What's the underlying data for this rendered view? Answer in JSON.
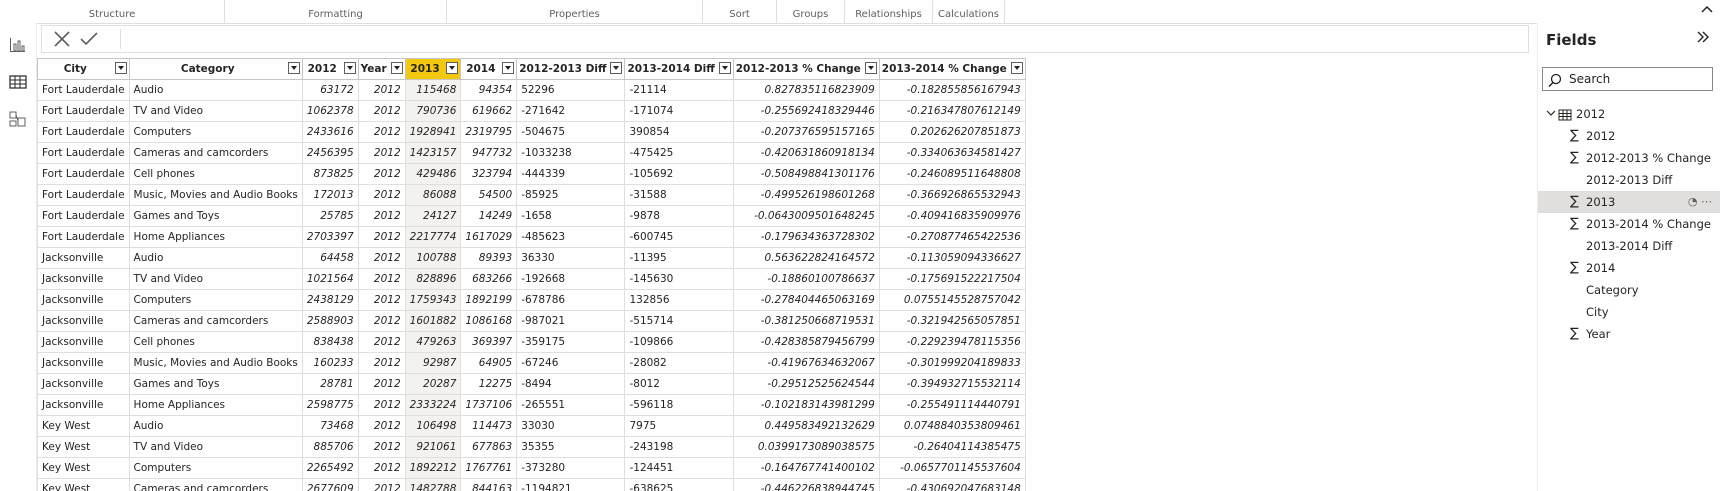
{
  "ribbon": {
    "groups": [
      "Structure",
      "Formatting",
      "Properties",
      "Sort",
      "Groups",
      "Relationships",
      "Calculations"
    ]
  },
  "icons": {
    "rail": [
      "report-view-icon",
      "table-view-icon",
      "model-view-icon"
    ],
    "formula": [
      "cancel-icon",
      "commit-icon"
    ]
  },
  "table": {
    "columns": [
      "City",
      "Category",
      "2012",
      "Year",
      "2013",
      "2014",
      "2012-2013 Diff",
      "2013-2014 Diff",
      "2012-2013 % Change",
      "2013-2014 % Change"
    ],
    "selected_column": "2013",
    "rows": [
      [
        "Fort Lauderdale",
        "Audio",
        "63172",
        "2012",
        "115468",
        "94354",
        "52296",
        "-21114",
        "0.827835116823909",
        "-0.182855856167943"
      ],
      [
        "Fort Lauderdale",
        "TV and Video",
        "1062378",
        "2012",
        "790736",
        "619662",
        "-271642",
        "-171074",
        "-0.255692418329446",
        "-0.216347807612149"
      ],
      [
        "Fort Lauderdale",
        "Computers",
        "2433616",
        "2012",
        "1928941",
        "2319795",
        "-504675",
        "390854",
        "-0.207376595157165",
        "0.202626207851873"
      ],
      [
        "Fort Lauderdale",
        "Cameras and camcorders",
        "2456395",
        "2012",
        "1423157",
        "947732",
        "-1033238",
        "-475425",
        "-0.420631860918134",
        "-0.334063634581427"
      ],
      [
        "Fort Lauderdale",
        "Cell phones",
        "873825",
        "2012",
        "429486",
        "323794",
        "-444339",
        "-105692",
        "-0.508498841301176",
        "-0.246089511648808"
      ],
      [
        "Fort Lauderdale",
        "Music, Movies and Audio Books",
        "172013",
        "2012",
        "86088",
        "54500",
        "-85925",
        "-31588",
        "-0.499526198601268",
        "-0.366926865532943"
      ],
      [
        "Fort Lauderdale",
        "Games and Toys",
        "25785",
        "2012",
        "24127",
        "14249",
        "-1658",
        "-9878",
        "-0.0643009501648245",
        "-0.409416835909976"
      ],
      [
        "Fort Lauderdale",
        "Home Appliances",
        "2703397",
        "2012",
        "2217774",
        "1617029",
        "-485623",
        "-600745",
        "-0.179634363728302",
        "-0.270877465422536"
      ],
      [
        "Jacksonville",
        "Audio",
        "64458",
        "2012",
        "100788",
        "89393",
        "36330",
        "-11395",
        "0.563622824164572",
        "-0.113059094336627"
      ],
      [
        "Jacksonville",
        "TV and Video",
        "1021564",
        "2012",
        "828896",
        "683266",
        "-192668",
        "-145630",
        "-0.18860100786637",
        "-0.175691522217504"
      ],
      [
        "Jacksonville",
        "Computers",
        "2438129",
        "2012",
        "1759343",
        "1892199",
        "-678786",
        "132856",
        "-0.278404465063169",
        "0.0755145528757042"
      ],
      [
        "Jacksonville",
        "Cameras and camcorders",
        "2588903",
        "2012",
        "1601882",
        "1086168",
        "-987021",
        "-515714",
        "-0.381250668719531",
        "-0.321942565057851"
      ],
      [
        "Jacksonville",
        "Cell phones",
        "838438",
        "2012",
        "479263",
        "369397",
        "-359175",
        "-109866",
        "-0.428385879456799",
        "-0.229239478115356"
      ],
      [
        "Jacksonville",
        "Music, Movies and Audio Books",
        "160233",
        "2012",
        "92987",
        "64905",
        "-67246",
        "-28082",
        "-0.41967634632067",
        "-0.301999204189833"
      ],
      [
        "Jacksonville",
        "Games and Toys",
        "28781",
        "2012",
        "20287",
        "12275",
        "-8494",
        "-8012",
        "-0.29512525624544",
        "-0.394932715532114"
      ],
      [
        "Jacksonville",
        "Home Appliances",
        "2598775",
        "2012",
        "2333224",
        "1737106",
        "-265551",
        "-596118",
        "-0.102183143981299",
        "-0.255491114440791"
      ],
      [
        "Key West",
        "Audio",
        "73468",
        "2012",
        "106498",
        "114473",
        "33030",
        "7975",
        "0.449583492132629",
        "0.0748840353809461"
      ],
      [
        "Key West",
        "TV and Video",
        "885706",
        "2012",
        "921061",
        "677863",
        "35355",
        "-243198",
        "0.0399173089038575",
        "-0.26404114385475"
      ],
      [
        "Key West",
        "Computers",
        "2265492",
        "2012",
        "1892212",
        "1767761",
        "-373280",
        "-124451",
        "-0.164767741400102",
        "-0.0657701145537604"
      ],
      [
        "Key West",
        "Cameras and camcorders",
        "2677609",
        "2012",
        "1482788",
        "844163",
        "-1194821",
        "-638625",
        "-0.446226838944745",
        "-0.430692047683148"
      ]
    ]
  },
  "fields": {
    "title": "Fields",
    "search_placeholder": "Search",
    "table_name": "2012",
    "items": [
      {
        "label": "2012",
        "sigma": true
      },
      {
        "label": "2012-2013 % Change",
        "sigma": true
      },
      {
        "label": "2012-2013 Diff",
        "sigma": false
      },
      {
        "label": "2013",
        "sigma": true,
        "highlighted": true
      },
      {
        "label": "2013-2014 % Change",
        "sigma": true
      },
      {
        "label": "2013-2014 Diff",
        "sigma": false
      },
      {
        "label": "2014",
        "sigma": true
      },
      {
        "label": "Category",
        "sigma": false
      },
      {
        "label": "City",
        "sigma": false
      },
      {
        "label": "Year",
        "sigma": true
      }
    ]
  },
  "colors": {
    "accent": "#f2c811",
    "selected_cell": "#f3f2f1",
    "highlight_row": "#e1dfdd"
  }
}
